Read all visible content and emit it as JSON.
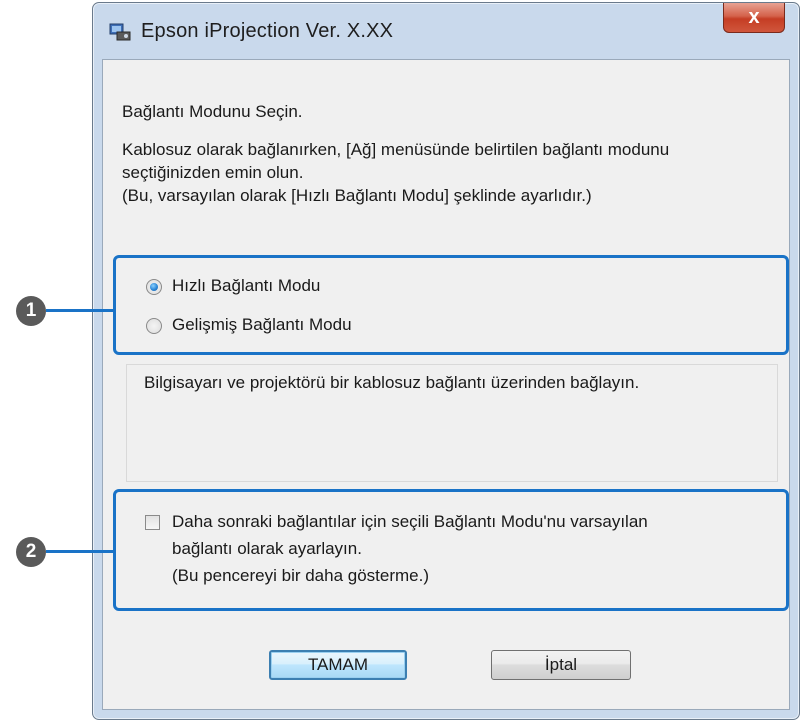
{
  "window": {
    "title": "Epson iProjection Ver. X.XX",
    "close_label": "x"
  },
  "dialog": {
    "heading": "Bağlantı Modunu Seçin.",
    "info_line1": "Kablosuz olarak bağlanırken, [Ağ] menüsünde belirtilen bağlantı modunu",
    "info_line2": "seçtiğinizden emin olun.",
    "info_line3": "(Bu, varsayılan olarak [Hızlı Bağlantı Modu] şeklinde ayarlıdır.)",
    "modes": [
      {
        "label": "Hızlı Bağlantı Modu",
        "selected": true
      },
      {
        "label": "Gelişmiş Bağlantı Modu",
        "selected": false
      }
    ],
    "mode_description": "Bilgisayarı ve projektörü bir kablosuz bağlantı üzerinden bağlayın.",
    "default_checkbox": {
      "line1": "Daha sonraki bağlantılar için seçili Bağlantı Modu'nu varsayılan",
      "line2": "bağlantı olarak ayarlayın.",
      "line3": "(Bu pencereyi bir daha gösterme.)",
      "checked": false
    },
    "ok_label": "TAMAM",
    "cancel_label": "İptal"
  },
  "callouts": [
    "1",
    "2"
  ],
  "colors": {
    "highlight": "#1a73c7"
  }
}
